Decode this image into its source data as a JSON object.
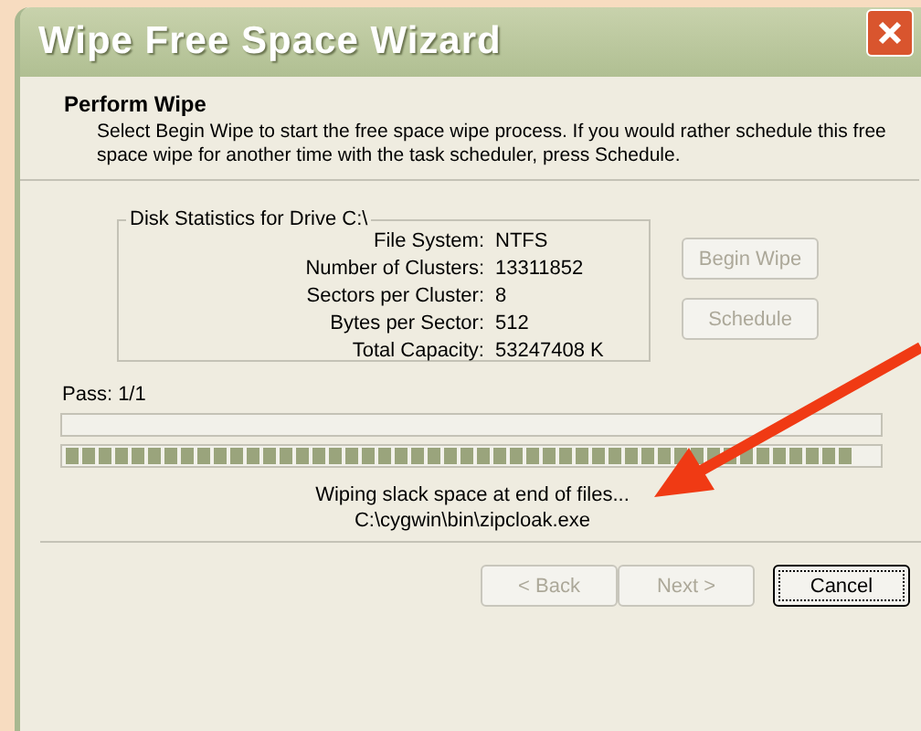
{
  "window": {
    "title": "Wipe Free Space Wizard"
  },
  "header": {
    "title": "Perform Wipe",
    "description": "Select Begin Wipe to start the free space wipe process. If you would rather schedule this free space wipe for another time with the task scheduler, press Schedule."
  },
  "disk_statistics": {
    "title": "Disk Statistics for Drive C:\\",
    "rows": [
      {
        "label": "File System:",
        "value": "NTFS"
      },
      {
        "label": "Number of Clusters:",
        "value": "13311852"
      },
      {
        "label": "Sectors per Cluster:",
        "value": "8"
      },
      {
        "label": "Bytes per Sector:",
        "value": "512"
      },
      {
        "label": "Total Capacity:",
        "value": "53247408 K"
      }
    ]
  },
  "side_buttons": [
    {
      "label": "Begin Wipe",
      "disabled": true
    },
    {
      "label": "Schedule",
      "disabled": true
    }
  ],
  "pass": {
    "label": "Pass: 1/1"
  },
  "progress_bars": [
    {
      "level": 0
    },
    {
      "level": 0.97
    }
  ],
  "status": [
    "Wiping slack space at end of files...",
    "C:\\cygwin\\bin\\zipcloak.exe"
  ],
  "nav_buttons": [
    {
      "label": "< Back",
      "disabled": true,
      "focused": false
    },
    {
      "label": "Next >",
      "disabled": true,
      "focused": false
    },
    {
      "label": "Cancel",
      "disabled": false,
      "focused": true
    }
  ]
}
